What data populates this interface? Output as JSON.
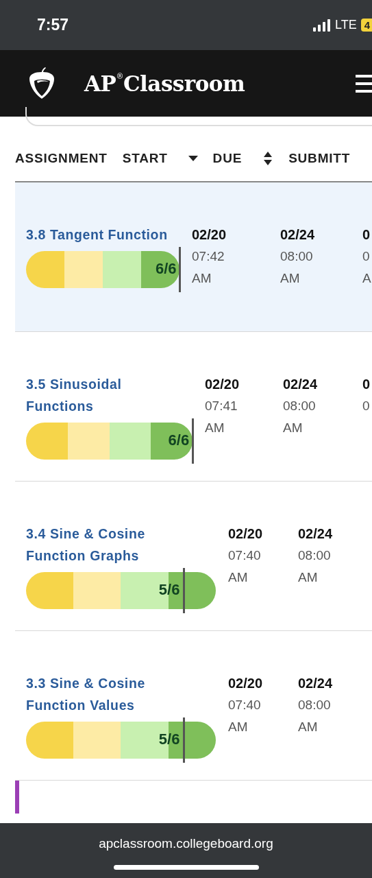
{
  "status_bar": {
    "time": "7:57",
    "network": "LTE",
    "battery": "4"
  },
  "header": {
    "title": "AP$^{®}$Classroom"
  },
  "table": {
    "columns": [
      {
        "label": "ASSIGNMENT",
        "kind": "plain"
      },
      {
        "label": "START",
        "kind": "sorted"
      },
      {
        "label": "DUE",
        "kind": "sortable"
      },
      {
        "label": "SUBMITT",
        "kind": "plain"
      }
    ],
    "rows": [
      {
        "title": "3.8 Tangent Function",
        "selected": true,
        "score": "6/6",
        "level": 1,
        "start_date": "02/20",
        "start_time": "07:42",
        "start_ampm": "AM",
        "due_date": "02/24",
        "due_time": "08:00",
        "due_ampm": "AM",
        "submitted_date": "0",
        "submitted_time": "0",
        "submitted_ampm": "A"
      },
      {
        "title": "3.5 Sinusoidal Functions",
        "selected": false,
        "score": "6/6",
        "level": 1,
        "start_date": "02/20",
        "start_time": "07:41",
        "start_ampm": "AM",
        "due_date": "02/24",
        "due_time": "08:00",
        "due_ampm": "AM",
        "submitted_date": "0",
        "submitted_time": "0"
      },
      {
        "title": "3.4 Sine & Cosine Function Graphs",
        "selected": false,
        "score": "5/6",
        "level": 0.83,
        "start_date": "02/20",
        "start_time": "07:40",
        "start_ampm": "AM",
        "due_date": "02/24",
        "due_time": "08:00",
        "due_ampm": "AM"
      },
      {
        "title": "3.3 Sine & Cosine Function Values",
        "selected": false,
        "score": "5/6",
        "level": 0.83,
        "start_date": "02/20",
        "start_time": "07:40",
        "start_ampm": "AM",
        "due_date": "02/24",
        "due_time": "08:00",
        "due_ampm": "AM"
      },
      {
        "color": "#9b3fb5",
        "selected": false
      }
    ]
  },
  "browser_bar": {
    "url": "apclassroom.collegeboard.org"
  }
}
